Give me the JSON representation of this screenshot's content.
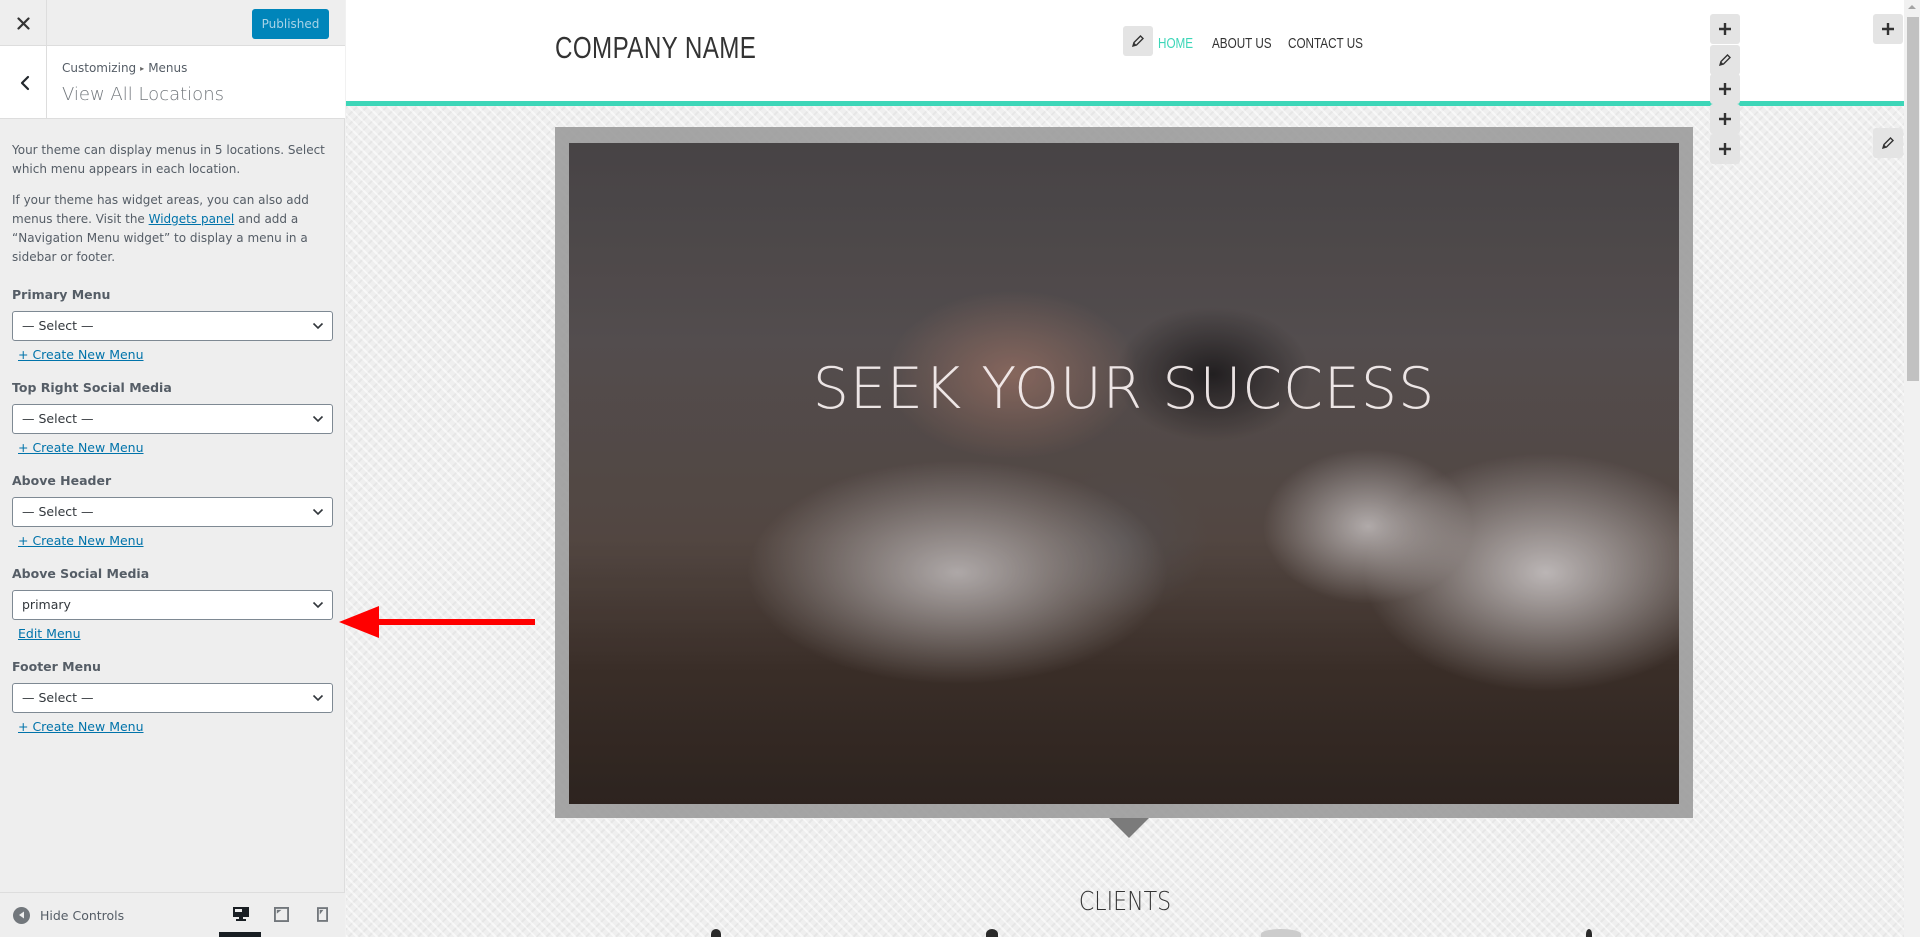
{
  "customizer": {
    "close_label": "Close",
    "publish_button": "Published",
    "breadcrumb": {
      "root": "Customizing",
      "separator": "▸",
      "current": "Menus"
    },
    "section_title": "View All Locations",
    "description_1": "Your theme can display menus in 5 locations. Select which menu appears in each location.",
    "description_2_before": "If your theme has widget areas, you can also add menus there. Visit the ",
    "description_2_link": "Widgets panel",
    "description_2_after": " and add a “Navigation Menu widget” to display a menu in a sidebar or footer.",
    "locations": [
      {
        "label": "Primary Menu",
        "selected": "— Select —",
        "link": "+ Create New Menu"
      },
      {
        "label": "Top Right Social Media",
        "selected": "— Select —",
        "link": "+ Create New Menu"
      },
      {
        "label": "Above Header",
        "selected": "— Select —",
        "link": "+ Create New Menu"
      },
      {
        "label": "Above Social Media",
        "selected": "primary",
        "link": "Edit Menu"
      },
      {
        "label": "Footer Menu",
        "selected": "— Select —",
        "link": "+ Create New Menu"
      }
    ],
    "footer": {
      "hide_controls": "Hide Controls",
      "devices": [
        "desktop",
        "tablet",
        "mobile"
      ],
      "active_device": "desktop"
    }
  },
  "preview": {
    "company_name": "COMPANY NAME",
    "nav": [
      {
        "label": "HOME",
        "active": true
      },
      {
        "label": "ABOUT US",
        "active": false
      },
      {
        "label": "CONTACT US",
        "active": false
      }
    ],
    "hero_title": "SEEK YOUR SUCCESS",
    "clients_title": "CLIENTS",
    "shortcut_controls": [
      "plus",
      "pencil",
      "plus",
      "plus",
      "plus"
    ],
    "right_controls": [
      "plus",
      "pencil"
    ]
  },
  "colors": {
    "accent_teal": "#3dd6b8",
    "publish_blue": "#0085ba",
    "link_blue": "#0073aa",
    "annotation_red": "#ff0000"
  }
}
